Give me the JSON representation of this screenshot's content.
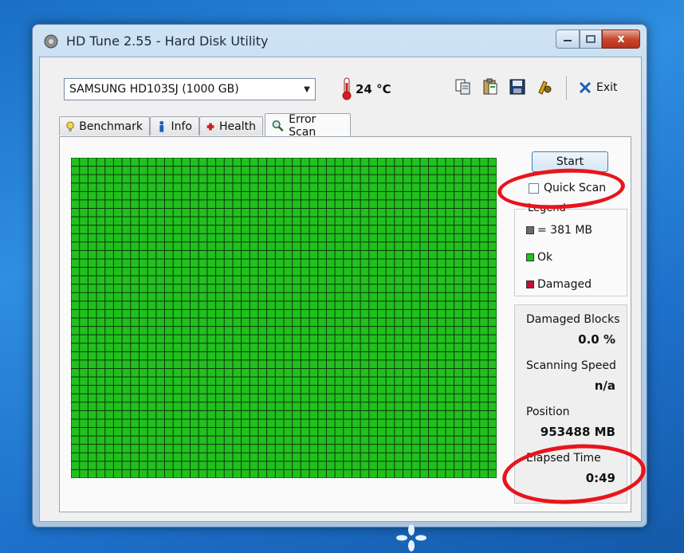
{
  "window": {
    "title": "HD Tune 2.55 - Hard Disk Utility",
    "close_label": "x"
  },
  "header": {
    "drive": "SAMSUNG HD103SJ (1000 GB)",
    "temperature": "24 °C",
    "exit_label": "Exit"
  },
  "tabs": [
    {
      "label": "Benchmark",
      "icon": "benchmark-icon"
    },
    {
      "label": "Info",
      "icon": "info-icon"
    },
    {
      "label": "Health",
      "icon": "health-icon"
    },
    {
      "label": "Error Scan",
      "icon": "magnifier-icon",
      "active": true
    }
  ],
  "scan": {
    "start_label": "Start",
    "quick_scan_label": "Quick Scan",
    "quick_scan_checked": false,
    "legend_title": "Legend",
    "legend": {
      "block_size": "= 381 MB",
      "ok": "Ok",
      "damaged": "Damaged"
    },
    "stats": {
      "damaged_blocks_label": "Damaged Blocks",
      "damaged_blocks_value": "0.0 %",
      "scanning_speed_label": "Scanning Speed",
      "scanning_speed_value": "n/a",
      "position_label": "Position",
      "position_value": "953488 MB",
      "elapsed_time_label": "Elapsed Time",
      "elapsed_time_value": "0:49"
    }
  },
  "colors": {
    "ok_green": "#22c01e",
    "damaged_red": "#c8102e",
    "block_gray": "#6b6b6b",
    "annotation_red": "#e8141c"
  }
}
